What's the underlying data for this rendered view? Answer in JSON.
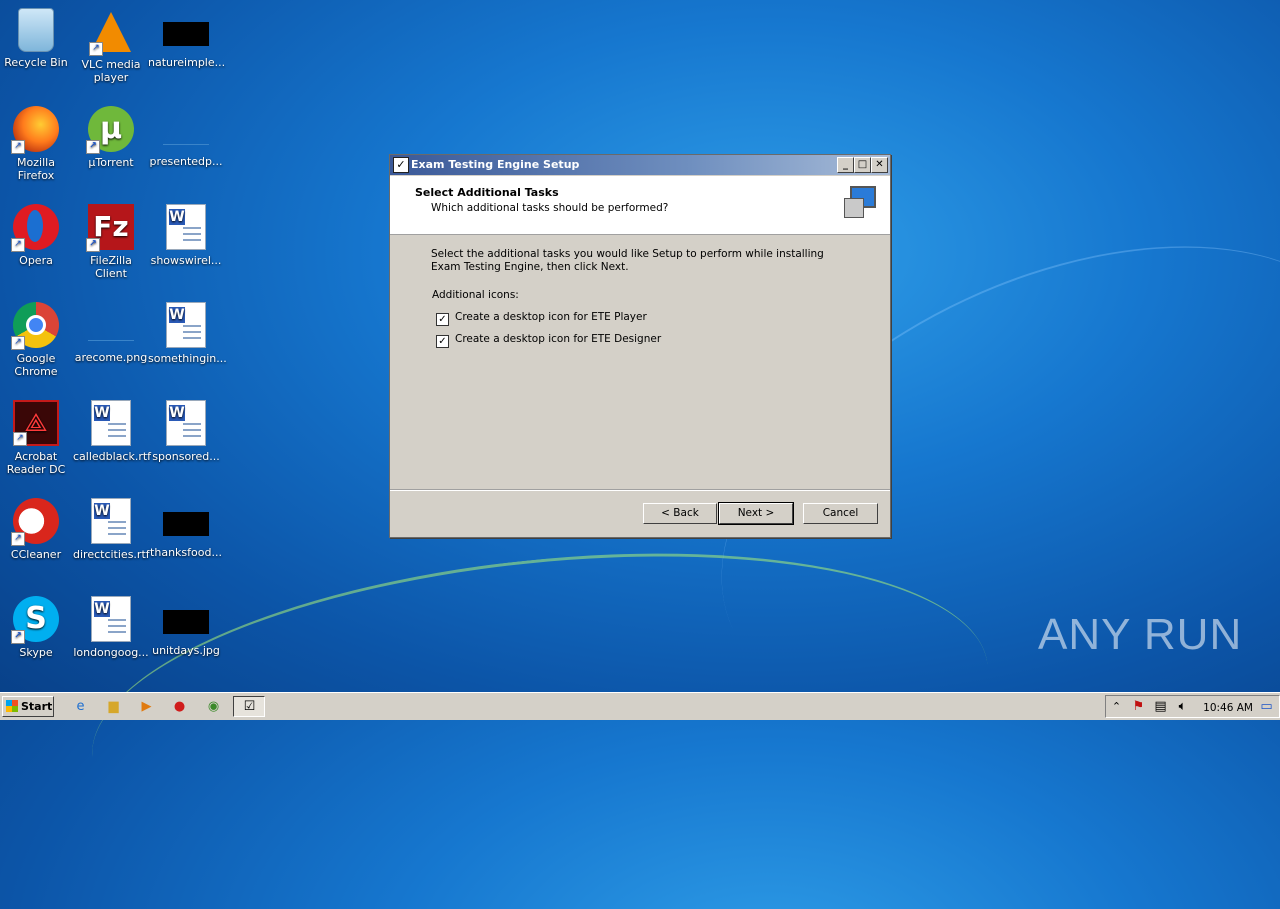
{
  "desktop": {
    "icons": [
      {
        "label": "Recycle Bin"
      },
      {
        "label": "VLC media player"
      },
      {
        "label": "natureimple..."
      },
      {
        "label": "Mozilla Firefox"
      },
      {
        "label": "µTorrent"
      },
      {
        "label": "presentedp..."
      },
      {
        "label": "Opera"
      },
      {
        "label": "FileZilla Client"
      },
      {
        "label": "showswirel..."
      },
      {
        "label": "Google Chrome"
      },
      {
        "label": "arecome.png"
      },
      {
        "label": "somethingin..."
      },
      {
        "label": "Acrobat Reader DC"
      },
      {
        "label": "calledblack.rtf"
      },
      {
        "label": "sponsored..."
      },
      {
        "label": "CCleaner"
      },
      {
        "label": "directcities.rtf"
      },
      {
        "label": "thanksfood..."
      },
      {
        "label": "Skype"
      },
      {
        "label": "londongoog..."
      },
      {
        "label": "unitdays.jpg"
      }
    ]
  },
  "dialog": {
    "title": "Exam Testing Engine Setup",
    "header_title": "Select Additional Tasks",
    "header_subtitle": "Which additional tasks should be performed?",
    "body_text": "Select the additional tasks you would like Setup to perform while installing Exam Testing Engine, then click Next.",
    "section_label": "Additional icons:",
    "tasks": [
      {
        "label": "Create a desktop icon for ETE Player",
        "checked": true
      },
      {
        "label": "Create a desktop icon for ETE Designer",
        "checked": true
      }
    ],
    "buttons": {
      "back": "< Back",
      "next": "Next >",
      "cancel": "Cancel"
    }
  },
  "taskbar": {
    "start_label": "Start",
    "clock": "10:46 AM"
  },
  "watermark": "ANY RUN"
}
